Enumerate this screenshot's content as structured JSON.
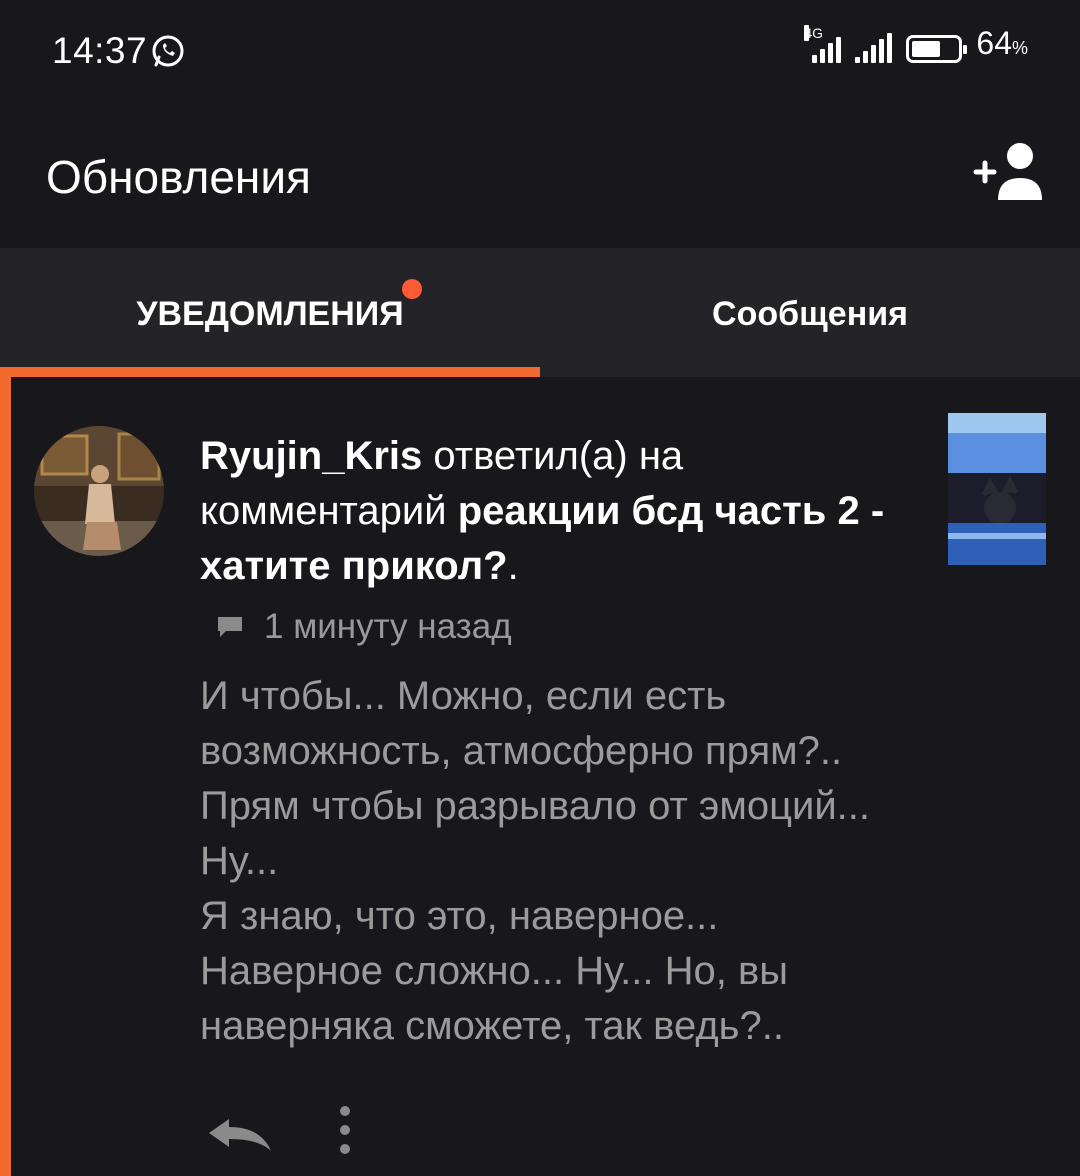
{
  "status_bar": {
    "time": "14:37",
    "network": "4G",
    "battery_percent": "64",
    "battery_unit": "%",
    "battery_level": 0.64
  },
  "header": {
    "title": "Обновления"
  },
  "tabs": [
    {
      "label": "УВЕДОМЛЕНИЯ",
      "active": true,
      "has_dot": true
    },
    {
      "label": "Сообщения",
      "active": false,
      "has_dot": false
    }
  ],
  "notification": {
    "username": "Ryujin_Kris",
    "action": " ответил(а) на комментарий ",
    "post_title": "реакции бсд часть 2 - хатите прикол?",
    "end_punct": ".",
    "time_ago": "1 минуту назад",
    "body": "И чтобы... Можно, если есть возможность, атмосферно прям?.. Прям чтобы разрывало от эмоций... Ну...\nЯ знаю, что это, наверное...\nНаверное сложно... Ну... Но, вы наверняка сможете, так ведь?.."
  },
  "colors": {
    "background": "#18171b",
    "tab_bar": "#242328",
    "accent": "#f26a2e",
    "dot": "#ff5a36",
    "muted_text": "#9b9b9b"
  },
  "icons": {
    "whatsapp": "whatsapp-icon",
    "add_user": "add-user-icon",
    "comment": "comment-icon",
    "reply": "reply-icon",
    "more": "more-vertical-icon"
  }
}
